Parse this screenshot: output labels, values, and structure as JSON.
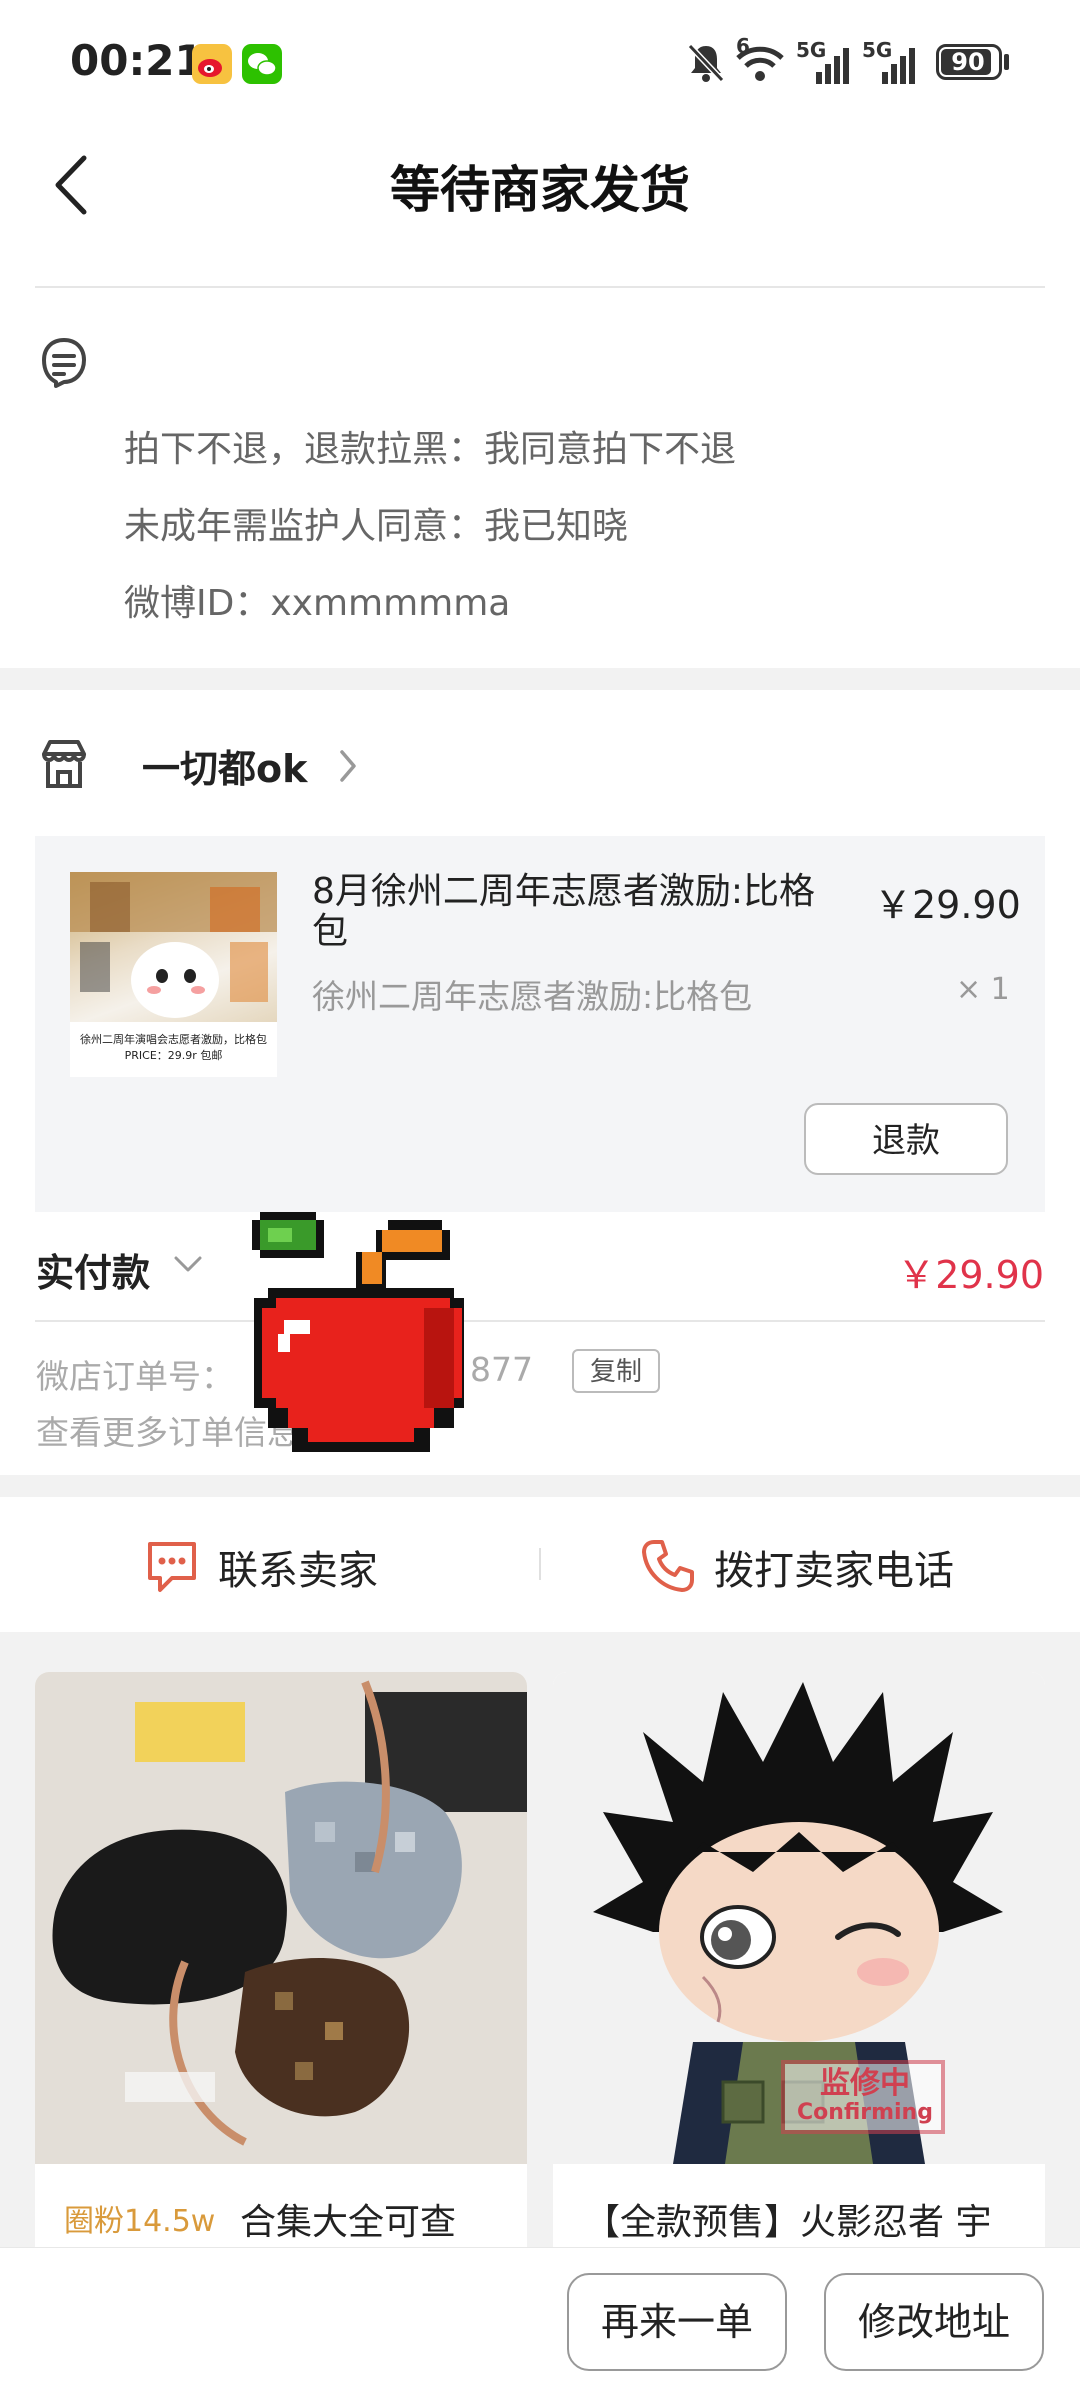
{
  "status_bar": {
    "time": "00:21",
    "battery": "90",
    "signal_1": "5G",
    "signal_2": "5G",
    "wifi_badge": "6",
    "icons": [
      "weibo-icon",
      "wechat-icon",
      "mute-icon",
      "wifi-icon",
      "signal-icon",
      "signal-icon",
      "battery-icon"
    ]
  },
  "header": {
    "title": "等待商家发货"
  },
  "notes": {
    "lines": [
      "拍下不退，退款拉黑：我同意拍下不退",
      "未成年需监护人同意：我已知晓",
      "微博ID：xxmmmmma"
    ]
  },
  "shop": {
    "name": "一切都ok",
    "item": {
      "title": "8月徐州二周年志愿者激励:比格包",
      "sku": "徐州二周年志愿者激励:比格包",
      "price": "￥29.90",
      "quantity": "× 1",
      "image_caption": "徐州二周年演唱会志愿者激励，比格包 PRICE：29.9r 包邮"
    },
    "refund_label": "退款",
    "paid_label": "实付款",
    "paid_amount": "￥29.90",
    "order_label": "微店订单号：",
    "order_number_tail": "877",
    "copy_label": "复制",
    "more_orders": "查看更多订单信息"
  },
  "contact": {
    "seller_label": "联系卖家",
    "call_label": "拨打卖家电话"
  },
  "recommendations": [
    {
      "fans_badge": "圈粉14.5w",
      "title": "合集大全可查"
    },
    {
      "title": "【全款预售】火影忍者 宇",
      "stamp_line1": "监修中",
      "stamp_line2": "Confirming"
    }
  ],
  "bottom_bar": {
    "reorder_label": "再来一单",
    "change_address_label": "修改地址"
  },
  "colors": {
    "accent_red": "#e0334a",
    "fans_gold": "#d99a3b",
    "contact_icon": "#e0604a"
  }
}
